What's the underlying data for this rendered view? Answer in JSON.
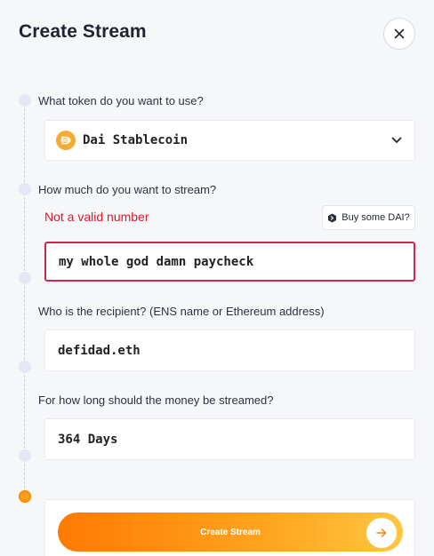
{
  "dialog": {
    "title": "Create Stream"
  },
  "token": {
    "question": "What token do you want to use?",
    "selected": "Dai Stablecoin",
    "icon": "dai-icon",
    "icon_color": "#f5ac37"
  },
  "amount": {
    "question": "How much do you want to stream?",
    "error": "Not a valid number",
    "buy_button_label": "Buy some DAI?",
    "value": "my whole god damn paycheck",
    "error_color": "#e0162b"
  },
  "recipient": {
    "question": "Who is the recipient? (ENS name or Ethereum address)",
    "value": "defidad.eth"
  },
  "duration": {
    "question": "For how long should the money be streamed?",
    "value": "364 Days"
  },
  "submit": {
    "label": "Create Stream",
    "accent_start": "#ff7a00",
    "accent_end": "#ffc640"
  }
}
